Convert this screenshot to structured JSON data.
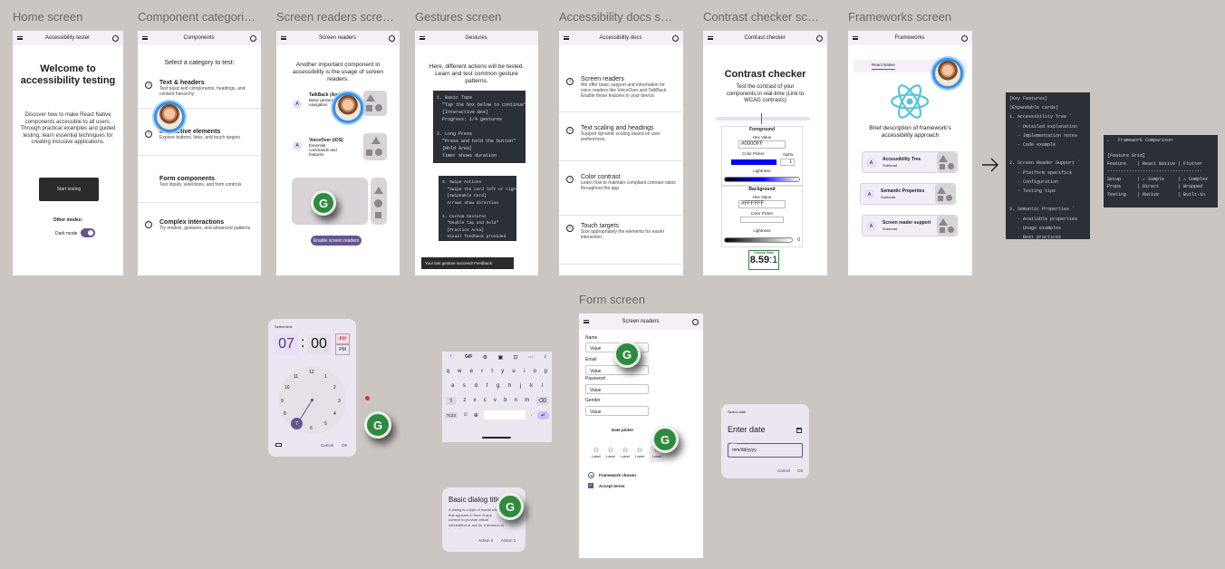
{
  "frame_titles": {
    "home": "Home screen",
    "components": "Component categori…",
    "screen_readers": "Screen readers scre…",
    "gestures": "Gestures screen",
    "docs": "Accessibility docs s…",
    "contrast": "Contrast checker sc…",
    "frameworks": "Frameworks screen",
    "form": "Form screen"
  },
  "home": {
    "appbar": "Accessibility tester",
    "heading": "Welcome to accessibility testing",
    "body": "Discover how to make React Native components accessible to all users. Through practical examples and guided testing, learn essential techniques for creating inclusive applications.",
    "start": "Start testing",
    "other_modes": "Other modes:",
    "dark_mode": "Dark mode"
  },
  "components": {
    "appbar": "Components",
    "subtitle": "Select a category to test:",
    "items": [
      {
        "title": "Text & headers",
        "desc": "Test basic text components, headings, and content hierarchy"
      },
      {
        "title": "Interactive elements",
        "desc": "Explore buttons, links, and touch targets"
      },
      {
        "title": "Form components",
        "desc": "Test inputs, selections, and form controls"
      },
      {
        "title": "Complex interactions",
        "desc": "Try models, gestures, and advanced patterns"
      }
    ]
  },
  "screen_readers": {
    "appbar": "Screen readers",
    "intro": "Another important component in accessibility is the usage of screen readers.",
    "items": [
      {
        "avatar": "A",
        "title": "TalkBack (Android)",
        "desc": "Basic gestures and navigation"
      },
      {
        "avatar": "A",
        "title": "VoiceOver (iOS)",
        "desc": "Essential commands and features"
      }
    ],
    "button": "Enable screen readers"
  },
  "gestures": {
    "appbar": "Gestures",
    "intro": "Here, different actions will be tested. Learn and test common gesture patterns.",
    "code1": "1. Basic Taps\n  \"Tap the box below to continue\"\n  [Interactive Box]\n  Progress: 1/4 gestures\n\n2. Long Press\n  \"Press and hold the button\"\n  [Hold Area]\n  Timer shows duration",
    "code2": "3. Swipe Actions\n  \"Swipe the card left or right\"\n  [Swipeable Card]\n  Arrows show direction\n\n4. Custom Gestures\n  \"Double tap and hold\"\n  [Practice Area]\n  Visual feedback provided",
    "toast": "Your last gesture succeed! Feedback."
  },
  "docs": {
    "appbar": "Accessibility docs",
    "items": [
      {
        "title": "Screen readers",
        "desc": "We offer basic support and information for voice readers like VoiceOver and TalkBack. Enable these features in your device."
      },
      {
        "title": "Text scaling and headings",
        "desc": "Support dynamic scaling based on user preferences."
      },
      {
        "title": "Color contrast",
        "desc": "Learn how to maintain compliant contrast ratios throughout the app."
      },
      {
        "title": "Touch targets",
        "desc": "Size appropriately the elements for easier interaction."
      }
    ]
  },
  "contrast": {
    "appbar": "Contrast checker",
    "heading": "Contrast checker",
    "body": "Test the contrast of your components in real-time (Link to WCAG contrasts)",
    "foreground": "Foreground",
    "hex_label": "Hex Value",
    "fg_hex": "0000FF",
    "color_picker": "Color Picker",
    "alpha": "Alpha",
    "alpha_value": "1",
    "lightness": "Lightness",
    "background": "Background",
    "bg_hex": "FFFFFF",
    "lightness_value": "0",
    "ratio_label": "Contrast Ratio",
    "ratio": "8.59",
    "ratio_suffix": ":1",
    "fg_color": "#0000ff"
  },
  "frameworks": {
    "appbar": "Frameworks",
    "tab": "React Native",
    "desc": "Brief description of framework's accessibility approach",
    "items": [
      {
        "avatar": "A",
        "title": "Accessibility Tree",
        "sub": "Subhead"
      },
      {
        "avatar": "A",
        "title": "Semantic Properties",
        "sub": "Subhead"
      },
      {
        "avatar": "A",
        "title": "Screen reader support",
        "sub": "Subhead"
      }
    ]
  },
  "key_features": "[Key Features]\n(Expandable cards)\n1. Accessibility Tree ˇ\n   - Detailed explanation\n   - Implementation notes\n   - Code example\n\n2. Screen Reader Support ˇ\n   - Platform specifics\n   - Configuration\n   - Testing tips\n\n3. Semantic Properties ˇ\n   - Available properties\n   - Usage examples\n   - Best practices",
  "comparison": "←   Framework Comparison\n\n[Feature Grid]\nFeature    | React Native | Flutter\n-----------------------------------\nSetup      | ✓ Simple     | ⚠ Complex\nProps      | Direct       | Wrapped\nTesting    | Native       | Built-in",
  "time_picker": {
    "label": "Select time",
    "hour": "07",
    "sep": ":",
    "minute": "00",
    "am": "AM",
    "pm": "PM",
    "cancel": "Cancel",
    "ok": "OK",
    "selected": "7",
    "numbers": [
      "12",
      "1",
      "2",
      "3",
      "4",
      "5",
      "6",
      "7",
      "8",
      "9",
      "10",
      "11"
    ]
  },
  "keyboard": {
    "gif": "GIF",
    "row1": [
      "q",
      "w",
      "e",
      "r",
      "t",
      "y",
      "u",
      "i",
      "o",
      "p"
    ],
    "row2": [
      "a",
      "s",
      "d",
      "f",
      "g",
      "h",
      "j",
      "k",
      "l"
    ],
    "row3": [
      "z",
      "x",
      "c",
      "v",
      "b",
      "n",
      "m"
    ],
    "sym": "?123"
  },
  "dialog": {
    "title": "Basic dialog title",
    "body": "A dialog is a type of modal window that appears in front of app content to provide critical information or ask for a decision to be made.",
    "action2": "Action 2",
    "action1": "Action 1"
  },
  "form": {
    "appbar": "Screen readers",
    "fields": [
      {
        "label": "Name",
        "value": "Value"
      },
      {
        "label": "Email",
        "value": "Value"
      },
      {
        "label": "Password",
        "value": "Value"
      },
      {
        "label": "Gender",
        "value": "Value"
      }
    ],
    "date_picker": "Date picker",
    "star_labels": [
      "Label",
      "Label",
      "Label",
      "Label",
      "Label"
    ],
    "radio": "Framework chosen",
    "checkbox": "Accept terms"
  },
  "date_dialog": {
    "label": "Select date",
    "heading": "Enter date",
    "field_label": "Date",
    "placeholder": "mm/dd/yyyy",
    "cancel": "Cancel",
    "ok": "OK"
  },
  "grammarly": "G"
}
